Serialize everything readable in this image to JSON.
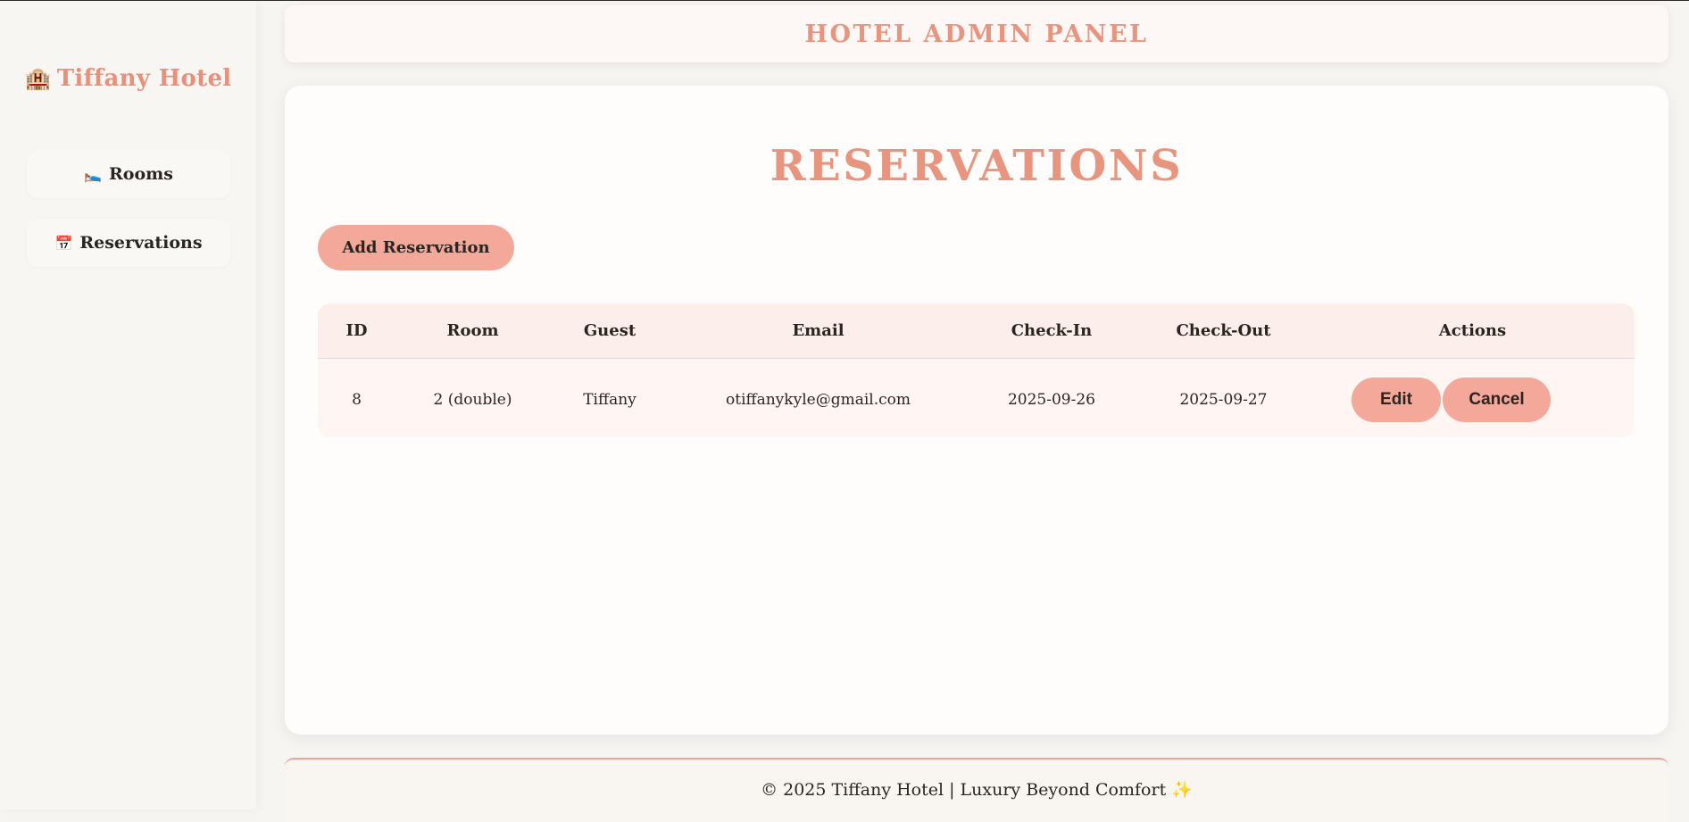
{
  "sidebar": {
    "brand_icon": "🏨",
    "brand_name": "Tiffany Hotel",
    "items": [
      {
        "icon": "🛌",
        "label": "Rooms"
      },
      {
        "icon": "📅",
        "label": "Reservations"
      }
    ]
  },
  "header": {
    "title": "HOTEL ADMIN PANEL"
  },
  "main": {
    "title": "RESERVATIONS",
    "add_button_label": "Add Reservation",
    "table": {
      "columns": [
        "ID",
        "Room",
        "Guest",
        "Email",
        "Check-In",
        "Check-Out",
        "Actions"
      ],
      "rows": [
        {
          "id": "8",
          "room": "2 (double)",
          "guest": "Tiffany",
          "email": "otiffanykyle@gmail.com",
          "check_in": "2025-09-26",
          "check_out": "2025-09-27",
          "edit_label": "Edit",
          "cancel_label": "Cancel"
        }
      ]
    }
  },
  "footer": {
    "text": "© 2025 Tiffany Hotel | Luxury Beyond Comfort ✨"
  },
  "colors": {
    "accent": "#e8957f",
    "button": "#f3a899",
    "background": "#f7f5f2",
    "card": "#fffdfb"
  }
}
